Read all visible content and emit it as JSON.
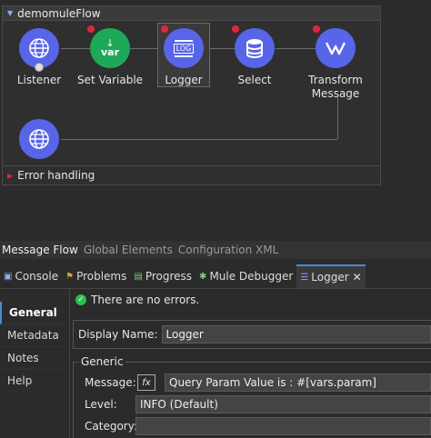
{
  "flow": {
    "name": "demomuleFlow",
    "nodes": [
      {
        "label": "Listener"
      },
      {
        "label": "Set Variable",
        "icon_text": "var"
      },
      {
        "label": "Logger",
        "icon_text": "LOG"
      },
      {
        "label": "Select"
      },
      {
        "label": "Transform\nMessage"
      }
    ],
    "error_handling": "Error handling"
  },
  "view_tabs": [
    "Message Flow",
    "Global Elements",
    "Configuration XML"
  ],
  "panel_tabs": [
    {
      "label": "Console"
    },
    {
      "label": "Problems"
    },
    {
      "label": "Progress"
    },
    {
      "label": "Mule Debugger"
    },
    {
      "label": "Logger",
      "close": "✕"
    }
  ],
  "side_nav": [
    "General",
    "Metadata",
    "Notes",
    "Help"
  ],
  "status_text": "There are no errors.",
  "display_name": {
    "label": "Display Name:",
    "value": "Logger"
  },
  "generic": {
    "legend": "Generic",
    "message_label": "Message:",
    "fx": "fx",
    "message_value": "Query Param Value is : #[vars.param]",
    "level_label": "Level:",
    "level_value": "INFO (Default)",
    "category_label": "Category:",
    "category_value": ""
  },
  "colors": {
    "accent": "#4a8ad6",
    "node_blue": "#5865e8",
    "node_green": "#1ea85a",
    "error_red": "#e0283a"
  }
}
